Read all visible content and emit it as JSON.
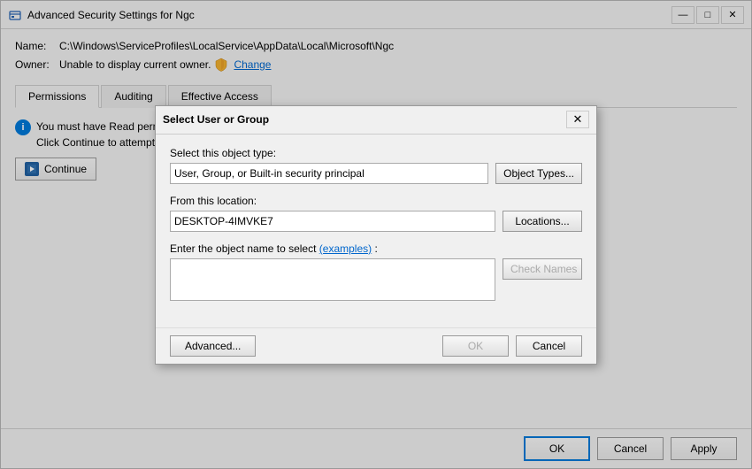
{
  "mainWindow": {
    "title": "Advanced Security Settings for Ngc",
    "nameLabel": "Name:",
    "namePath": "C:\\Windows\\ServiceProfiles\\LocalService\\AppData\\Local\\Microsoft\\Ngc",
    "ownerLabel": "Owner:",
    "ownerValue": "Unable to display current owner.",
    "changeLink": "Change",
    "tabs": [
      {
        "id": "permissions",
        "label": "Permissions",
        "active": true
      },
      {
        "id": "auditing",
        "label": "Auditing",
        "active": false
      },
      {
        "id": "effective-access",
        "label": "Effective Access",
        "active": false
      }
    ],
    "infoMessage1": "You must have Read permissions to view the properties of this object.",
    "infoMessage2": "Click Continue to attempt the operation with administrative privileges.",
    "continueBtn": "Continue",
    "footer": {
      "okLabel": "OK",
      "cancelLabel": "Cancel",
      "applyLabel": "Apply"
    }
  },
  "dialog": {
    "title": "Select User or Group",
    "objectTypeLabel": "Select this object type:",
    "objectTypeValue": "User, Group, or Built-in security principal",
    "objectTypesBtn": "Object Types...",
    "locationLabel": "From this location:",
    "locationValue": "DESKTOP-4IMVKE7",
    "locationsBtn": "Locations...",
    "objectNameLabel": "Enter the object name to select",
    "examplesLabel": "(examples)",
    "checkNamesBtn": "Check Names",
    "advancedBtn": "Advanced...",
    "okBtn": "OK",
    "cancelBtn": "Cancel"
  },
  "icons": {
    "shield": "🛡",
    "info": "i",
    "continue": "▶",
    "minimize": "—",
    "maximize": "□",
    "close": "✕"
  }
}
